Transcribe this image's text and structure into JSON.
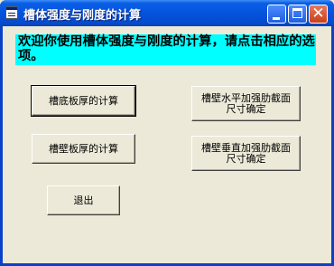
{
  "window": {
    "title": "槽体强度与刚度的计算"
  },
  "banner": {
    "text": "欢迎你使用槽体强度与刚度的计算，请点击相应的选项。",
    "background": "#00ffff"
  },
  "buttons": {
    "bottom_plate": "槽底板厚的计算",
    "wall_thickness": "槽壁板厚的计算",
    "horizontal_rib": "槽壁水平加强肋截面\n尺寸确定",
    "vertical_rib": "槽壁垂直加强肋截面\n尺寸确定",
    "exit": "退出"
  },
  "colors": {
    "titlebar": "#0553dc",
    "window_bg": "#ece9d8",
    "close_button": "#c9401b"
  }
}
